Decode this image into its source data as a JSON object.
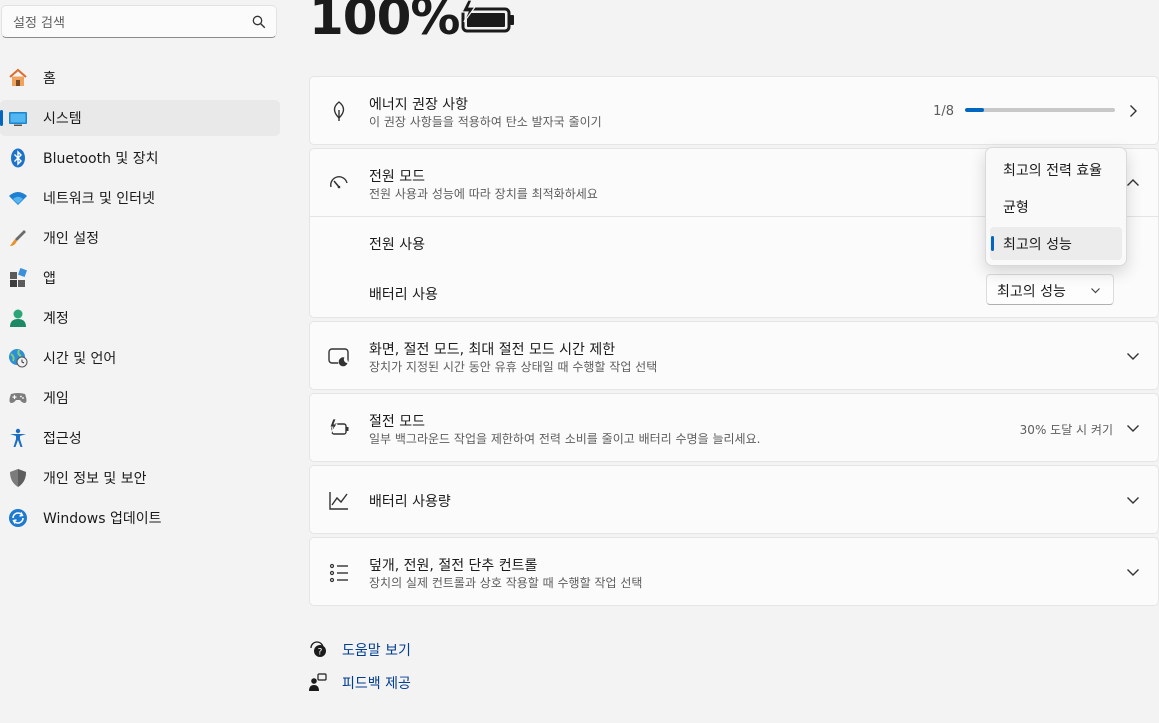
{
  "search": {
    "placeholder": "설정 검색"
  },
  "sidebar": {
    "items": [
      {
        "label": "홈"
      },
      {
        "label": "시스템"
      },
      {
        "label": "Bluetooth 및 장치"
      },
      {
        "label": "네트워크 및 인터넷"
      },
      {
        "label": "개인 설정"
      },
      {
        "label": "앱"
      },
      {
        "label": "계정"
      },
      {
        "label": "시간 및 언어"
      },
      {
        "label": "게임"
      },
      {
        "label": "접근성"
      },
      {
        "label": "개인 정보 및 보안"
      },
      {
        "label": "Windows 업데이트"
      }
    ]
  },
  "battery": {
    "percent": "100%"
  },
  "energy": {
    "title": "에너지 권장 사항",
    "subtitle": "이 권장 사항들을 적용하여 탄소 발자국 줄이기",
    "progress_text": "1/8",
    "progress_fraction": 0.125
  },
  "power_mode": {
    "title": "전원 모드",
    "subtitle": "전원 사용과 성능에 따라 장치를 최적화하세요",
    "plugged_label": "전원 사용",
    "battery_label": "배터리 사용",
    "battery_value": "최고의 성능",
    "options": [
      "최고의 전력 효율",
      "균형",
      "최고의 성능"
    ],
    "selected_option": "최고의 성능"
  },
  "screen_sleep": {
    "title": "화면, 절전 모드, 최대 절전 모드 시간 제한",
    "subtitle": "장치가 지정된 시간 동안 유휴 상태일 때 수행할 작업 선택"
  },
  "saver": {
    "title": "절전 모드",
    "subtitle": "일부 백그라운드 작업을 제한하여 전력 소비를 줄이고 배터리 수명을 늘리세요.",
    "status": "30% 도달 시 켜기"
  },
  "usage": {
    "title": "배터리 사용량"
  },
  "lid": {
    "title": "덮개, 전원, 절전 단추 컨트롤",
    "subtitle": "장치의 실제 컨트롤과 상호 작용할 때 수행할 작업 선택"
  },
  "links": {
    "help": "도움말 보기",
    "feedback": "피드백 제공"
  },
  "colors": {
    "accent": "#0067c0",
    "link": "#003e92",
    "background": "#f3f3f3"
  },
  "icons": {
    "search": "search-icon",
    "home": "home-icon",
    "system": "monitor-icon",
    "bluetooth": "bluetooth-icon",
    "network": "wifi-icon",
    "personalize": "brush-icon",
    "apps": "apps-icon",
    "accounts": "person-icon",
    "time": "globe-clock-icon",
    "gaming": "gamepad-icon",
    "accessibility": "accessibility-icon",
    "privacy": "shield-icon",
    "update": "sync-icon"
  }
}
